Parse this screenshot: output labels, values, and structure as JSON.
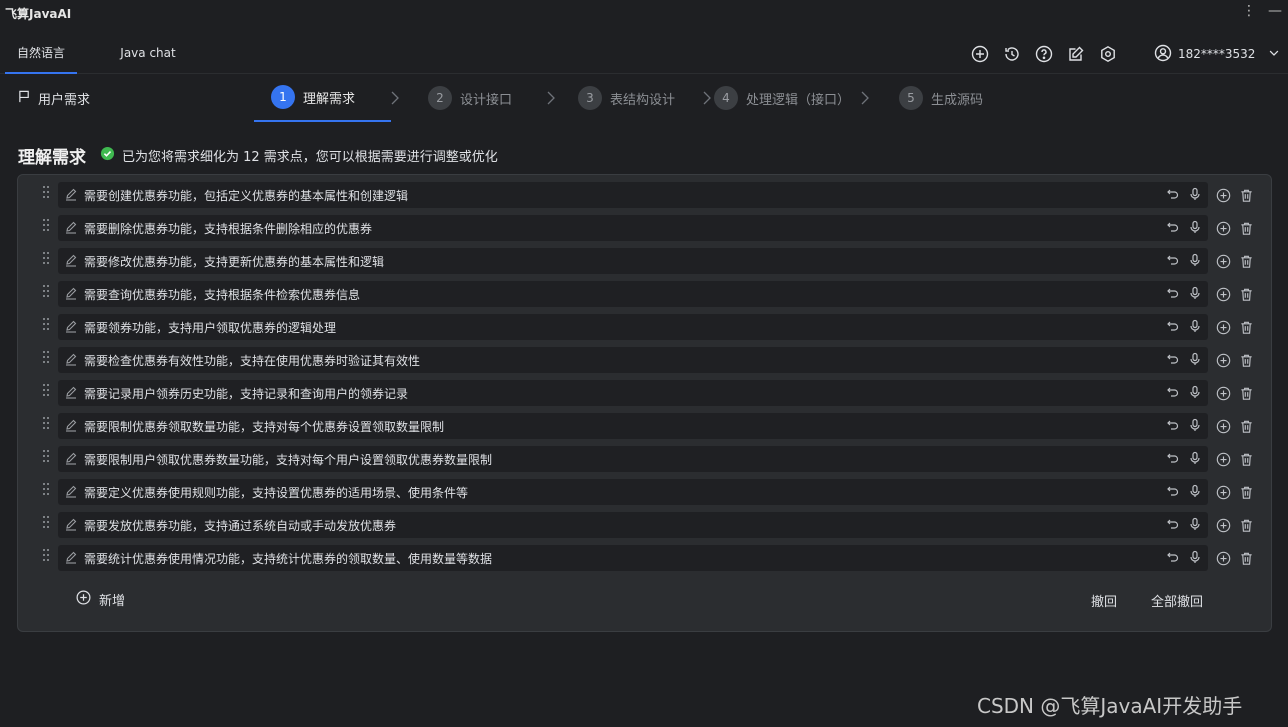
{
  "app": {
    "title": "飞算JavaAI"
  },
  "tabs": [
    {
      "label": "自然语言"
    },
    {
      "label": "Java chat"
    }
  ],
  "user": {
    "phone": "182****3532"
  },
  "sidebar": {
    "user_requirement": "用户需求"
  },
  "steps": [
    {
      "num": "1",
      "label": "理解需求"
    },
    {
      "num": "2",
      "label": "设计接口"
    },
    {
      "num": "3",
      "label": "表结构设计"
    },
    {
      "num": "4",
      "label": "处理逻辑（接口）"
    },
    {
      "num": "5",
      "label": "生成源码"
    }
  ],
  "heading": {
    "title": "理解需求",
    "summary": "已为您将需求细化为 12 需求点，您可以根据需要进行调整或优化"
  },
  "requirements": [
    "需要创建优惠券功能，包括定义优惠券的基本属性和创建逻辑",
    "需要删除优惠券功能，支持根据条件删除相应的优惠券",
    "需要修改优惠券功能，支持更新优惠券的基本属性和逻辑",
    "需要查询优惠券功能，支持根据条件检索优惠券信息",
    "需要领券功能，支持用户领取优惠券的逻辑处理",
    "需要检查优惠券有效性功能，支持在使用优惠券时验证其有效性",
    "需要记录用户领券历史功能，支持记录和查询用户的领券记录",
    "需要限制优惠券领取数量功能，支持对每个优惠券设置领取数量限制",
    "需要限制用户领取优惠券数量功能，支持对每个用户设置领取优惠券数量限制",
    "需要定义优惠券使用规则功能，支持设置优惠券的适用场景、使用条件等",
    "需要发放优惠券功能，支持通过系统自动或手动发放优惠券",
    "需要统计优惠券使用情况功能，支持统计优惠券的领取数量、使用数量等数据"
  ],
  "footer": {
    "add": "新增",
    "undo": "撤回",
    "undo_all": "全部撤回"
  },
  "watermark": "CSDN @飞算JavaAI开发助手",
  "colors": {
    "accent": "#3574f0",
    "success": "#3fb950",
    "background": "#1e1f22",
    "panel": "#2b2d30"
  }
}
